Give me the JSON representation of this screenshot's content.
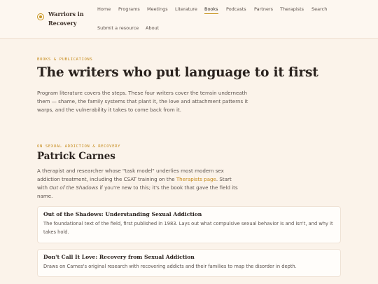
{
  "site": {
    "name": "Warriors in Recovery"
  },
  "nav": [
    {
      "label": "Home"
    },
    {
      "label": "Programs"
    },
    {
      "label": "Meetings"
    },
    {
      "label": "Literature"
    },
    {
      "label": "Books"
    },
    {
      "label": "Podcasts"
    },
    {
      "label": "Partners"
    },
    {
      "label": "Therapists"
    },
    {
      "label": "Search"
    },
    {
      "label": "Submit a resource"
    },
    {
      "label": "About"
    }
  ],
  "page": {
    "eyebrow": "BOOKS & PUBLICATIONS",
    "title": "The writers who put language to it first",
    "intro": "Program literature covers the steps. These four writers cover the terrain underneath them — shame, the family systems that plant it, the love and attachment patterns it warps, and the vulnerability it takes to come back from it."
  },
  "author": {
    "eyebrow": "ON SEXUAL ADDICTION & RECOVERY",
    "name": "Patrick Carnes",
    "bio_1": "A therapist and researcher whose \"task model\" underlies most modern sex addiction treatment, including the CSAT training on the ",
    "bio_link": "Therapists page",
    "bio_2": ". Start with ",
    "bio_book": "Out of the Shadows",
    "bio_3": " if you're new to this; it's the book that gave the field its name.",
    "books": [
      {
        "title": "Out of the Shadows: Understanding Sexual Addiction",
        "desc": "The foundational text of the field, first published in 1983. Lays out what compulsive sexual behavior is and isn't, and why it takes hold."
      },
      {
        "title": "Don't Call It Love: Recovery from Sexual Addiction",
        "desc": "Draws on Carnes's original research with recovering addicts and their families to map the disorder in depth."
      }
    ]
  },
  "colors": {
    "accent": "#c58a1a",
    "background": "#fbf3ea"
  }
}
